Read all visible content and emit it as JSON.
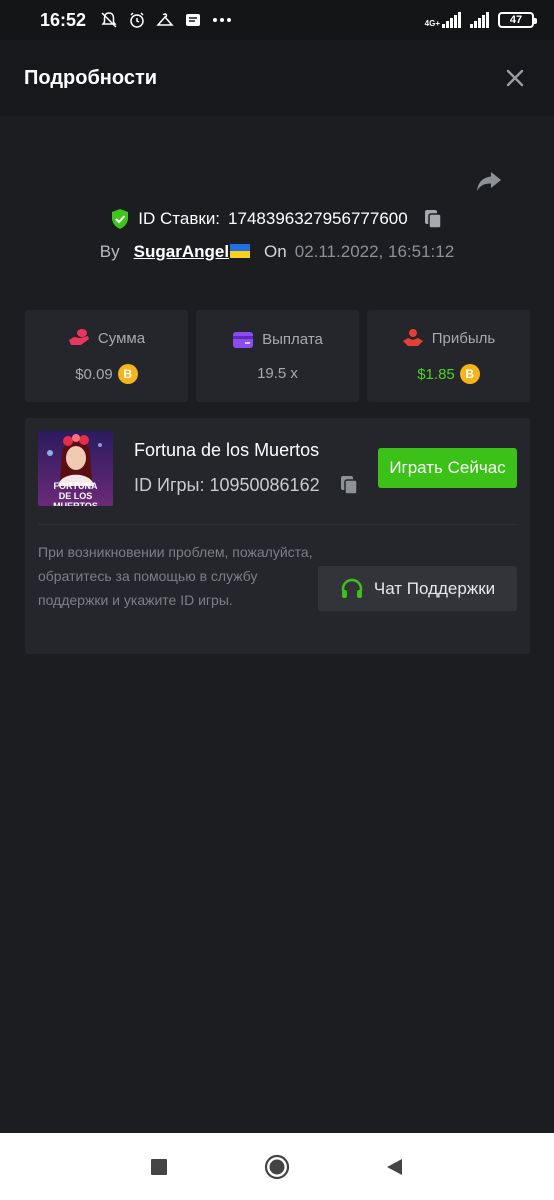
{
  "status_bar": {
    "time": "16:52",
    "network": "4G+",
    "battery": "47"
  },
  "header": {
    "title": "Подробности"
  },
  "bet": {
    "id_label": "ID Ставки:",
    "id_value": "1748396327956777600",
    "by_label": "By",
    "user": "SugarAngel",
    "on_label": "On",
    "date": "02.11.2022, 16:51:12"
  },
  "stats": [
    {
      "label": "Сумма",
      "value": "$0.09",
      "icon": "money-hand-icon",
      "icon_color": "#e9365f",
      "value_color": "#a7a9ae",
      "coin": true
    },
    {
      "label": "Выплата",
      "value": "19.5 x",
      "icon": "card-icon",
      "icon_color": "#8b4cf0",
      "value_color": "#a7a9ae",
      "coin": false
    },
    {
      "label": "Прибыль",
      "value": "$1.85",
      "icon": "profit-hand-icon",
      "icon_color": "#e63f37",
      "value_color": "#4bd322",
      "coin": true
    }
  ],
  "game": {
    "name": "Fortuna de los Muertos",
    "id_label": "ID Игры:",
    "id_value": "10950086162",
    "thumb_text_line1": "FORTUNA",
    "thumb_text_line2": "DE LOS MUERTOS",
    "play_label": "Играть Сейчас"
  },
  "support": {
    "help_text": "При возникновении проблем, пожалуйста, обратитесь за помощью в службу поддержки и укажите ID игры.",
    "button_label": "Чат Поддержки"
  },
  "colors": {
    "accent_green": "#3bc117",
    "shield_green": "#3fc51d",
    "coin": "#f5b31c"
  }
}
